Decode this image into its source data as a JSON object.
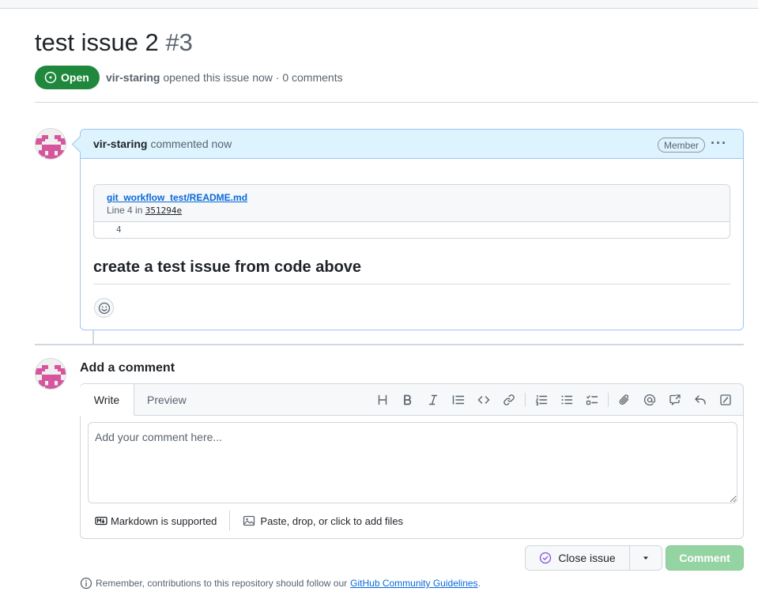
{
  "issue": {
    "title": "test issue 2",
    "number": "#3",
    "state": "Open",
    "author": "vir-staring",
    "meta_text": "opened this issue now · 0 comments"
  },
  "comment": {
    "author": "vir-staring",
    "action": "commented now",
    "badge": "Member",
    "more_icon": "kebab-horizontal-icon",
    "snippet": {
      "file": "git_workflow_test/README.md",
      "line_prefix": "Line 4 in",
      "sha": "351294e",
      "line_number": "4"
    },
    "body_heading": "create a test issue from code above"
  },
  "composer": {
    "title": "Add a comment",
    "tabs": [
      "Write",
      "Preview"
    ],
    "placeholder": "Add your comment here...",
    "markdown_hint": "Markdown is supported",
    "attach_hint": "Paste, drop, or click to add files",
    "toolbar_icons": [
      "heading-icon",
      "bold-icon",
      "italic-icon",
      "quote-icon",
      "code-icon",
      "link-icon",
      "ordered-list-icon",
      "unordered-list-icon",
      "task-list-icon",
      "attach-icon",
      "mention-icon",
      "cross-reference-icon",
      "reply-icon",
      "slash-command-icon"
    ]
  },
  "actions": {
    "close_issue": "Close issue",
    "comment": "Comment"
  },
  "footer": {
    "text": "Remember, contributions to this repository should follow our",
    "link": "GitHub Community Guidelines",
    "period": "."
  },
  "colors": {
    "open_green": "#1f883d",
    "link_blue": "#0969da",
    "header_blue": "#ddf4ff",
    "comment_disabled": "#94d3a2",
    "avatar_pink": "#d6559c"
  }
}
